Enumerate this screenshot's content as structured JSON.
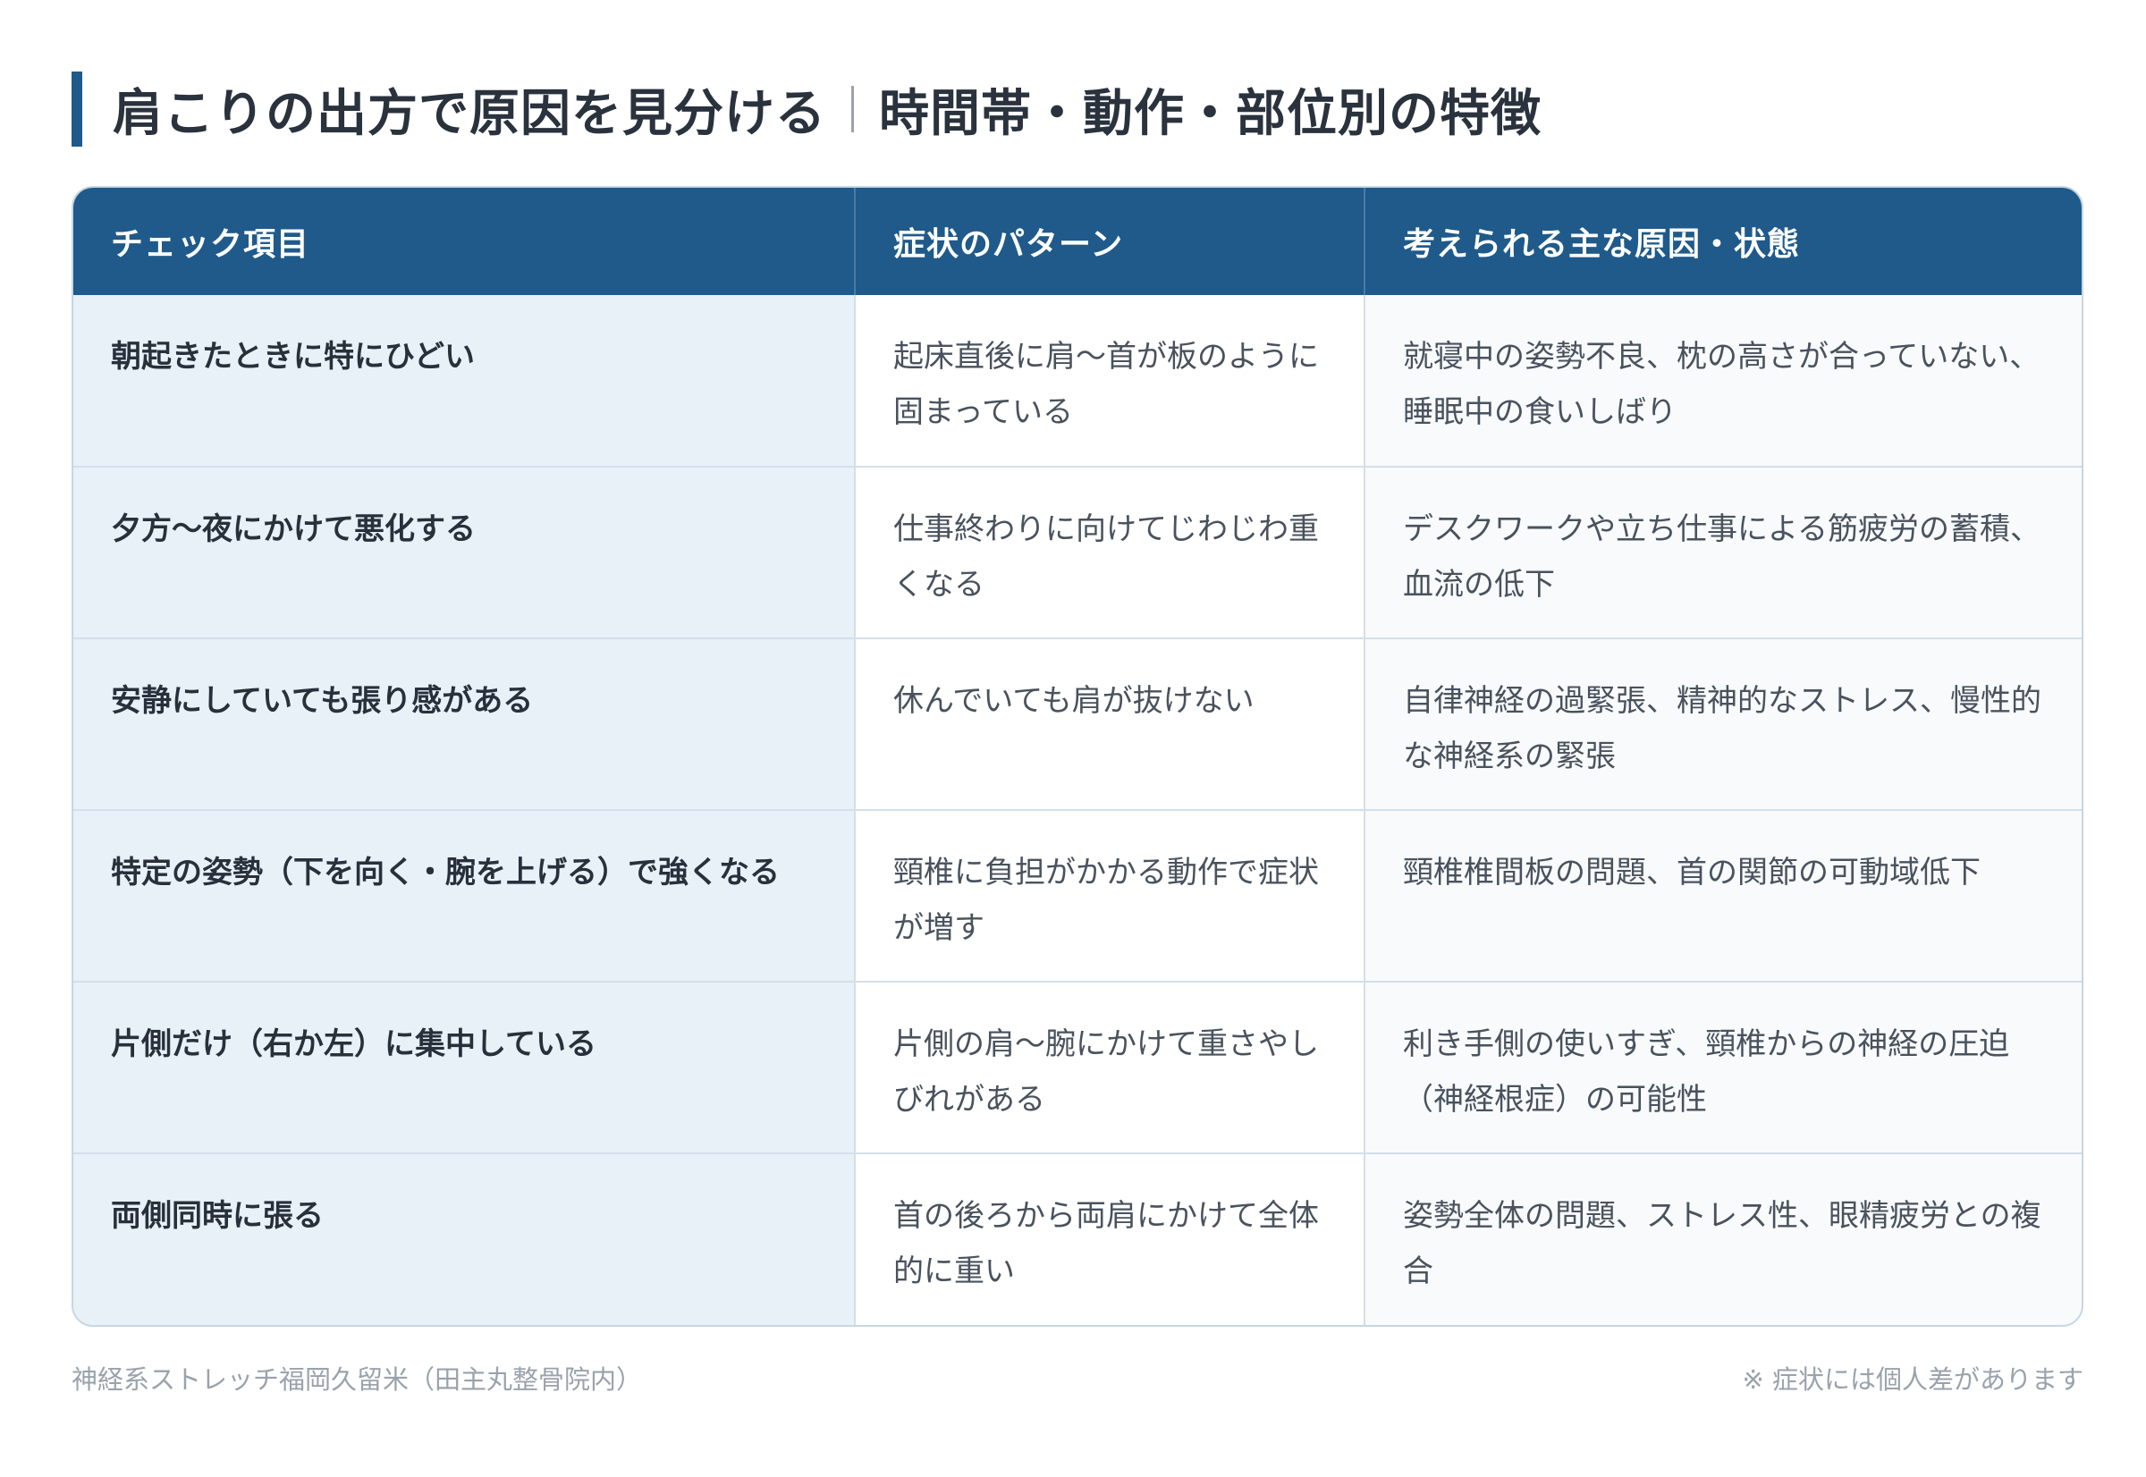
{
  "title": {
    "main": "肩こりの出方で原因を見分ける",
    "sub": "時間帯・動作・部位別の特徴"
  },
  "table": {
    "headers": [
      "チェック項目",
      "症状のパターン",
      "考えられる主な原因・状態"
    ],
    "rows": [
      {
        "check": "朝起きたときに特にひどい",
        "pattern": "起床直後に肩〜首が板のように固まっている",
        "cause": "就寝中の姿勢不良、枕の高さが合っていない、睡眠中の食いしばり"
      },
      {
        "check": "夕方〜夜にかけて悪化する",
        "pattern": "仕事終わりに向けてじわじわ重くなる",
        "cause": "デスクワークや立ち仕事による筋疲労の蓄積、血流の低下"
      },
      {
        "check": "安静にしていても張り感がある",
        "pattern": "休んでいても肩が抜けない",
        "cause": "自律神経の過緊張、精神的なストレス、慢性的な神経系の緊張"
      },
      {
        "check": "特定の姿勢（下を向く・腕を上げる）で強くなる",
        "pattern": "頸椎に負担がかかる動作で症状が増す",
        "cause": "頸椎椎間板の問題、首の関節の可動域低下"
      },
      {
        "check": "片側だけ（右か左）に集中している",
        "pattern": "片側の肩〜腕にかけて重さやしびれがある",
        "cause": "利き手側の使いすぎ、頸椎からの神経の圧迫（神経根症）の可能性"
      },
      {
        "check": "両側同時に張る",
        "pattern": "首の後ろから両肩にかけて全体的に重い",
        "cause": "姿勢全体の問題、ストレス性、眼精疲労との複合"
      }
    ]
  },
  "footer": {
    "source": "神経系ストレッチ福岡久留米（田主丸整骨院内）",
    "note": "※ 症状には個人差があります"
  },
  "colors": {
    "accent": "#1f5a8a",
    "check_column_bg": "#e8f0f8",
    "border": "#d3dfea"
  }
}
